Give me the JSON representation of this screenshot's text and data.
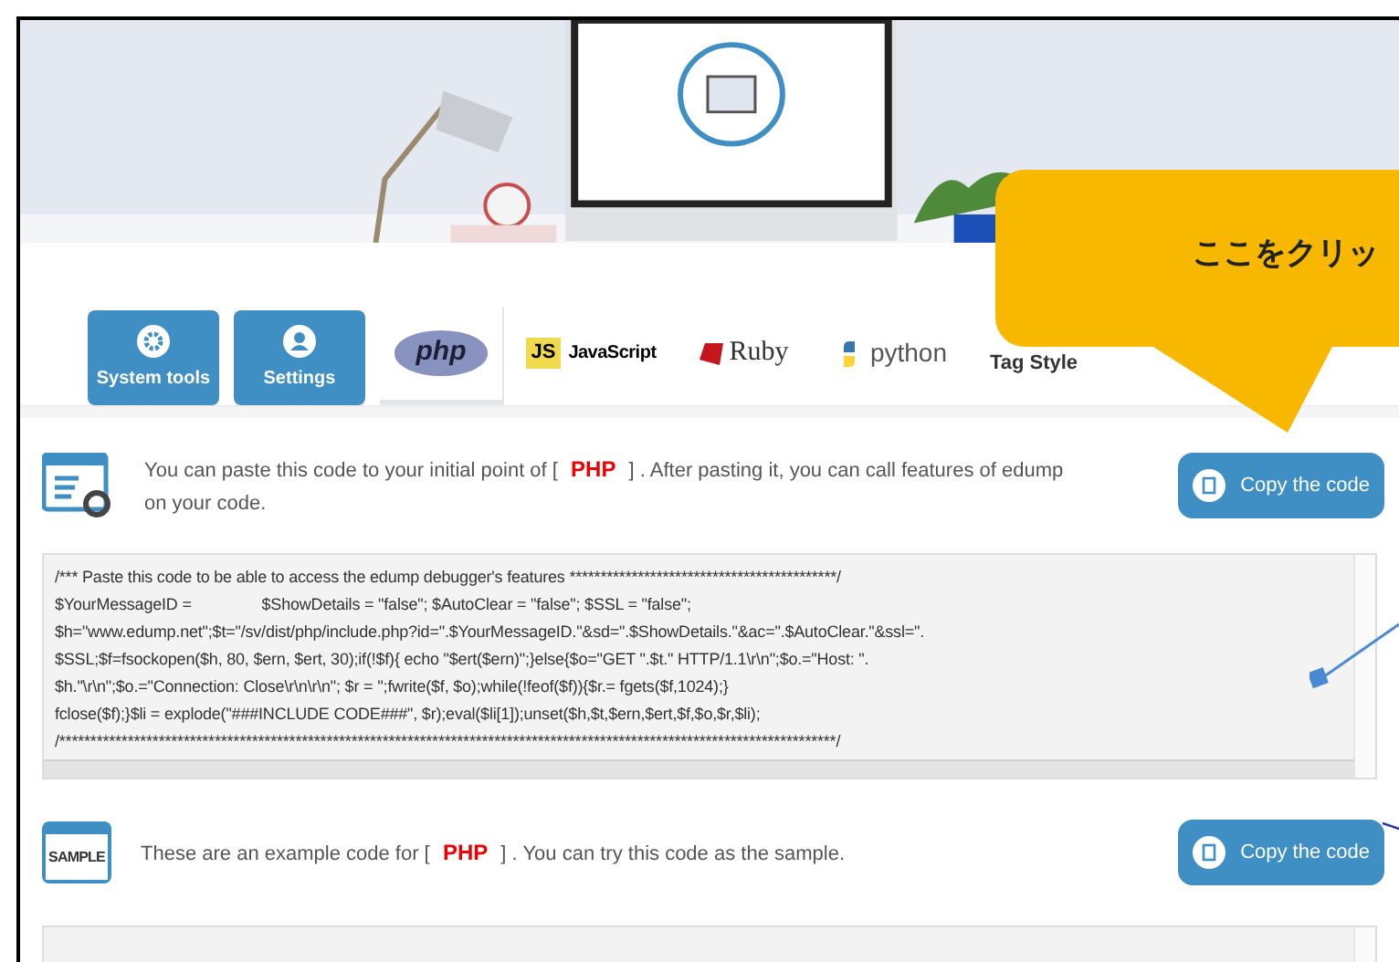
{
  "tabs": [
    {
      "kind": "gear",
      "label": "System tools",
      "selected": false
    },
    {
      "kind": "user",
      "label": "Settings",
      "selected": false
    },
    {
      "kind": "php",
      "label": "php",
      "selected": true
    },
    {
      "kind": "js",
      "badge": "JS",
      "label": "JavaScript",
      "selected": false
    },
    {
      "kind": "ruby",
      "label": "Ruby",
      "selected": false
    },
    {
      "kind": "python",
      "label": "python",
      "selected": false
    },
    {
      "kind": "text",
      "label": "Tag Style",
      "selected": false
    }
  ],
  "callout": {
    "text": "ここをクリッ"
  },
  "sections": [
    {
      "kind": "paste",
      "message": "You can paste this code to your initial point of [ **PHP** ] . After pasting it, you can call features of edump on your code.",
      "button": "Copy the code",
      "code": [
        "/*** Paste this code to be able to access the edump debugger's features *******************************************/",
        "$YourMessageID =                $ShowDetails = \"false\"; $AutoClear = \"false\"; $SSL = \"false\";",
        "$h=\"www.edump.net\";$t=\"/sv/dist/php/include.php?id=\".$YourMessageID.\"&sd=\".$ShowDetails.\"&ac=\".$AutoClear.\"&ssl=\".",
        "$SSL;$f=fsockopen($h, 80, $ern, $ert, 30);if(!$f){ echo \"$ert($ern)\";}else{$o=\"GET \".$t.\" HTTP/1.1\\r\\n\";$o.=\"Host: \".",
        "$h.\"\\r\\n\";$o.=\"Connection: Close\\r\\n\\r\\n\"; $r = '';fwrite($f, $o);while(!feof($f)){$r.= fgets($f,1024);}",
        "fclose($f);}$li = explode(\"###INCLUDE CODE###\", $r);eval($li[1]);unset($h,$t,$ern,$ert,$f,$o,$r,$li);",
        "/*****************************************************************************************************************************/"
      ]
    },
    {
      "kind": "sample",
      "icon_text": "SAMPLE",
      "message": "These are an example code for [ **PHP** ] . You can try this code as the sample.",
      "button": "Copy the code"
    }
  ]
}
